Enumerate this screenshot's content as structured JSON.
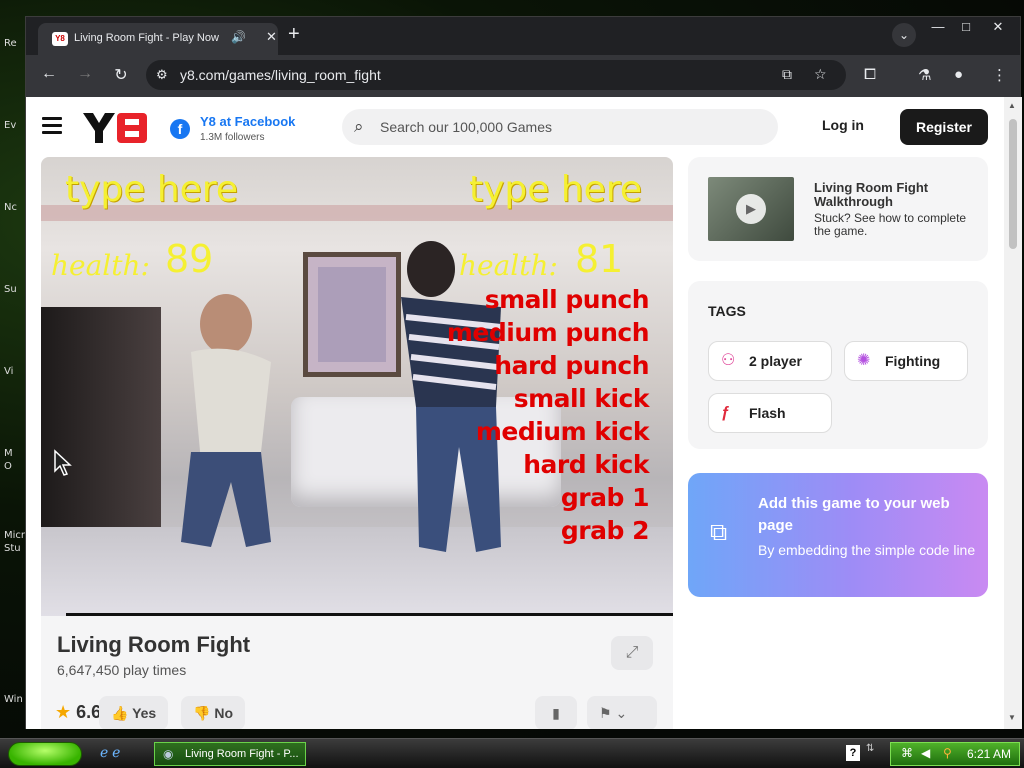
{
  "desktop": {
    "labels": [
      "Re",
      "Ev",
      "Nc",
      "Su",
      "Vi",
      "M",
      "O",
      "Micro",
      "Stu",
      "Win"
    ]
  },
  "browser": {
    "tab_title": "Living Room Fight - Play Now",
    "favicon_text": "Y8",
    "url": "y8.com/games/living_room_fight",
    "new_tab": "+",
    "tab_close": "✕"
  },
  "site": {
    "facebook_name": "Y8 at Facebook",
    "facebook_followers": "1.3M followers",
    "search_placeholder": "Search our 100,000 Games",
    "login": "Log in",
    "register": "Register"
  },
  "game": {
    "type_here_left": "type here",
    "type_here_right": "type here",
    "health_label": "health:",
    "health_left": "89",
    "health_right": "81",
    "moves": [
      "small punch",
      "medium punch",
      "hard punch",
      "small kick",
      "medium kick",
      "hard kick",
      "grab 1",
      "grab 2"
    ]
  },
  "game_info": {
    "title": "Living Room Fight",
    "play_times": "6,647,450 play times",
    "rating": "6.6",
    "yes": "Yes",
    "no": "No"
  },
  "sidebar": {
    "walkthrough_title": "Living Room Fight Walkthrough",
    "walkthrough_desc": "Stuck? See how to complete the game.",
    "tags_header": "TAGS",
    "tags": [
      {
        "label": "2 player",
        "icon": "two-player-icon"
      },
      {
        "label": "Fighting",
        "icon": "fighting-icon"
      },
      {
        "label": "Flash",
        "icon": "flash-icon"
      }
    ],
    "embed_title": "Add this game to your web page",
    "embed_desc": "By embedding the simple code line"
  },
  "taskbar": {
    "task_item": "Living Room Fight - P...",
    "clock": "6:21 AM"
  }
}
